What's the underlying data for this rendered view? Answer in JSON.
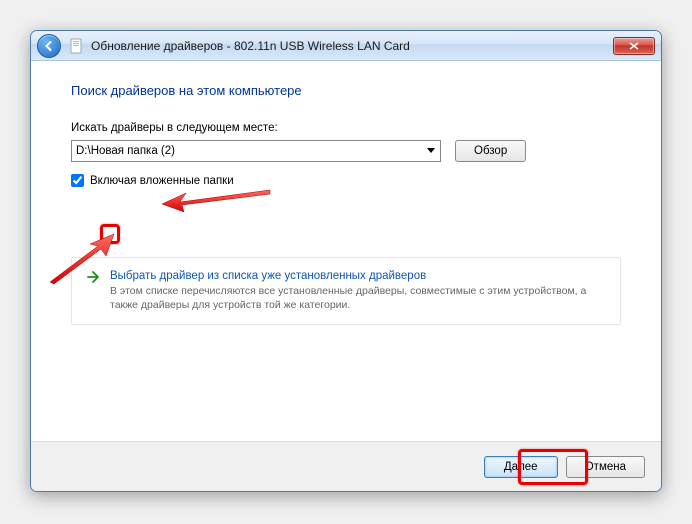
{
  "titlebar": {
    "title": "Обновление драйверов - 802.11n USB Wireless LAN Card"
  },
  "content": {
    "heading": "Поиск драйверов на этом компьютере",
    "search_label": "Искать драйверы в следующем месте:",
    "path_value": "D:\\Новая папка (2)",
    "browse_label": "Обзор",
    "include_sub_label": "Включая вложенные папки",
    "include_sub_checked": true
  },
  "info": {
    "title": "Выбрать драйвер из списка уже установленных драйверов",
    "desc": "В этом списке перечисляются все установленные драйверы, совместимые с этим устройством, а также драйверы для устройств той же категории."
  },
  "footer": {
    "next_label": "Далее",
    "cancel_label": "Отмена"
  },
  "colors": {
    "accent": "#0f55b6",
    "annotation": "#e80000"
  }
}
